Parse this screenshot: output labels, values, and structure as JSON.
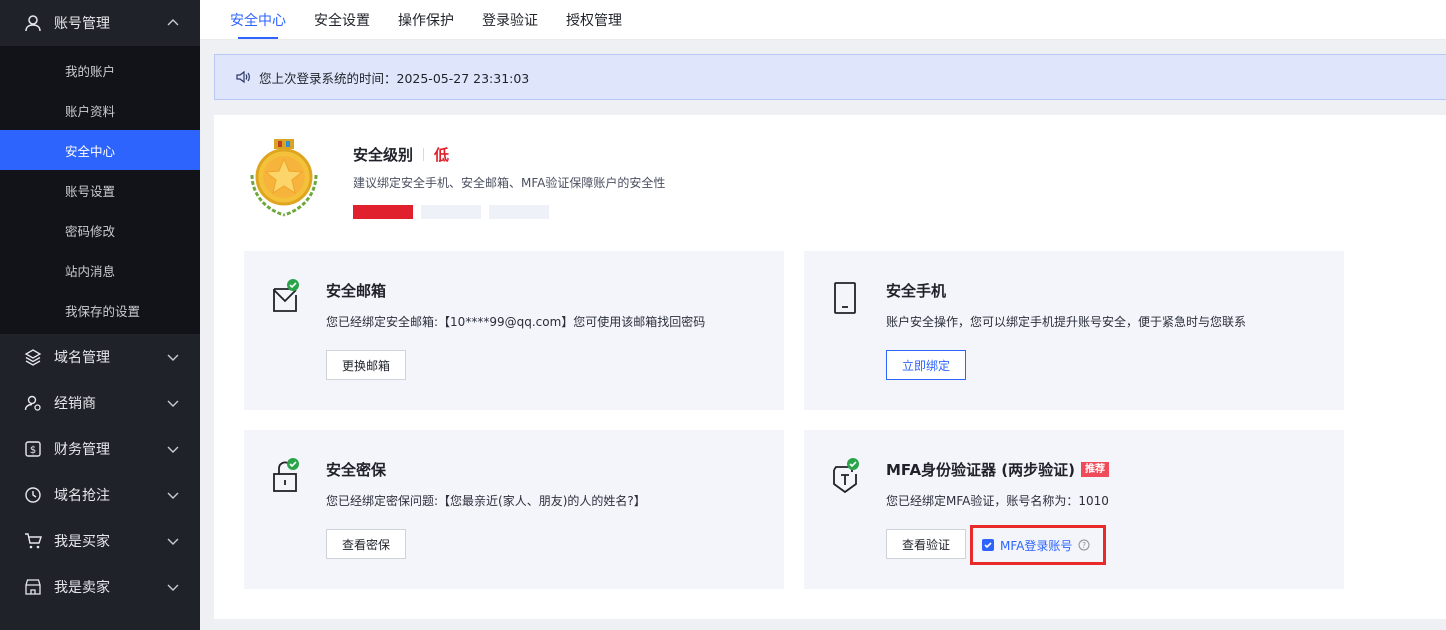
{
  "sidebar": {
    "account_group": {
      "label": "账号管理",
      "icon": "user-icon"
    },
    "sub_items": [
      {
        "label": "我的账户",
        "active": false
      },
      {
        "label": "账户资料",
        "active": false
      },
      {
        "label": "安全中心",
        "active": true
      },
      {
        "label": "账号设置",
        "active": false
      },
      {
        "label": "密码修改",
        "active": false
      },
      {
        "label": "站内消息",
        "active": false
      },
      {
        "label": "我保存的设置",
        "active": false
      }
    ],
    "groups": [
      {
        "label": "域名管理",
        "icon": "layers-icon"
      },
      {
        "label": "经销商",
        "icon": "user-gear-icon"
      },
      {
        "label": "财务管理",
        "icon": "dollar-icon"
      },
      {
        "label": "域名抢注",
        "icon": "clock-icon"
      },
      {
        "label": "我是买家",
        "icon": "cart-icon"
      },
      {
        "label": "我是卖家",
        "icon": "store-icon"
      }
    ]
  },
  "tabs": [
    "安全中心",
    "安全设置",
    "操作保护",
    "登录验证",
    "授权管理"
  ],
  "notice": {
    "text": "您上次登录系统的时间：2025-05-27 23:31:03",
    "icon": "speaker-icon"
  },
  "security_level": {
    "title": "安全级别",
    "value": "低",
    "description": "建议绑定安全手机、安全邮箱、MFA验证保障账户的安全性",
    "filled_segments": 1,
    "total_segments": 3
  },
  "cards": {
    "email": {
      "title": "安全邮箱",
      "description": "您已经绑定安全邮箱:【10****99@qq.com】您可使用该邮箱找回密码",
      "button": "更换邮箱",
      "icon": "envelope-check-icon"
    },
    "phone": {
      "title": "安全手机",
      "description": "账户安全操作，您可以绑定手机提升账号安全，便于紧急时与您联系",
      "button": "立即绑定",
      "icon": "phone-icon"
    },
    "question": {
      "title": "安全密保",
      "description": "您已经绑定密保问题:【您最亲近(家人、朋友)的人的姓名?】",
      "button": "查看密保",
      "icon": "lock-check-icon"
    },
    "mfa": {
      "title": "MFA身份验证器 (两步验证)",
      "badge": "推荐",
      "description": "您已经绑定MFA验证，账号名称为：1010",
      "button": "查看验证",
      "checkbox_label": "MFA登录账号",
      "checkbox_checked": true,
      "icon": "token-check-icon"
    }
  },
  "colors": {
    "accent": "#2e64fe",
    "danger": "#e0202c",
    "sidebar_bg": "#20222a",
    "highlight_box": "#ea2a2a"
  }
}
